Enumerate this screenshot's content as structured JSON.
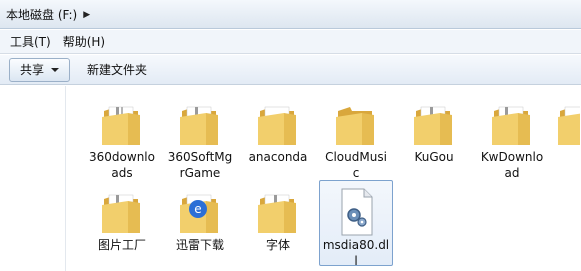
{
  "address": {
    "path": "本地磁盘 (F:)"
  },
  "menu": {
    "items": [
      "工具(T)",
      "帮助(H)"
    ]
  },
  "toolbar": {
    "share_label": "共享",
    "new_folder_label": "新建文件夹"
  },
  "files": [
    {
      "name": "360downloads",
      "icon": "folder-icon"
    },
    {
      "name": "360SoftMgrGame",
      "icon": "folder-icon"
    },
    {
      "name": "anaconda",
      "icon": "folder-icon"
    },
    {
      "name": "CloudMusic",
      "icon": "folder-icon"
    },
    {
      "name": "KuGou",
      "icon": "folder-icon"
    },
    {
      "name": "KwDownload",
      "icon": "folder-icon"
    },
    {
      "name": "图片工厂",
      "icon": "folder-icon"
    },
    {
      "name": "迅雷下载",
      "icon": "folder-icon"
    },
    {
      "name": "字体",
      "icon": "folder-icon"
    },
    {
      "name": "msdia80.dll",
      "icon": "dll-file-icon"
    }
  ],
  "colors": {
    "folder": "#f2cf6c",
    "folder_dark": "#d9a73c",
    "selection_border": "#7da2ce"
  }
}
